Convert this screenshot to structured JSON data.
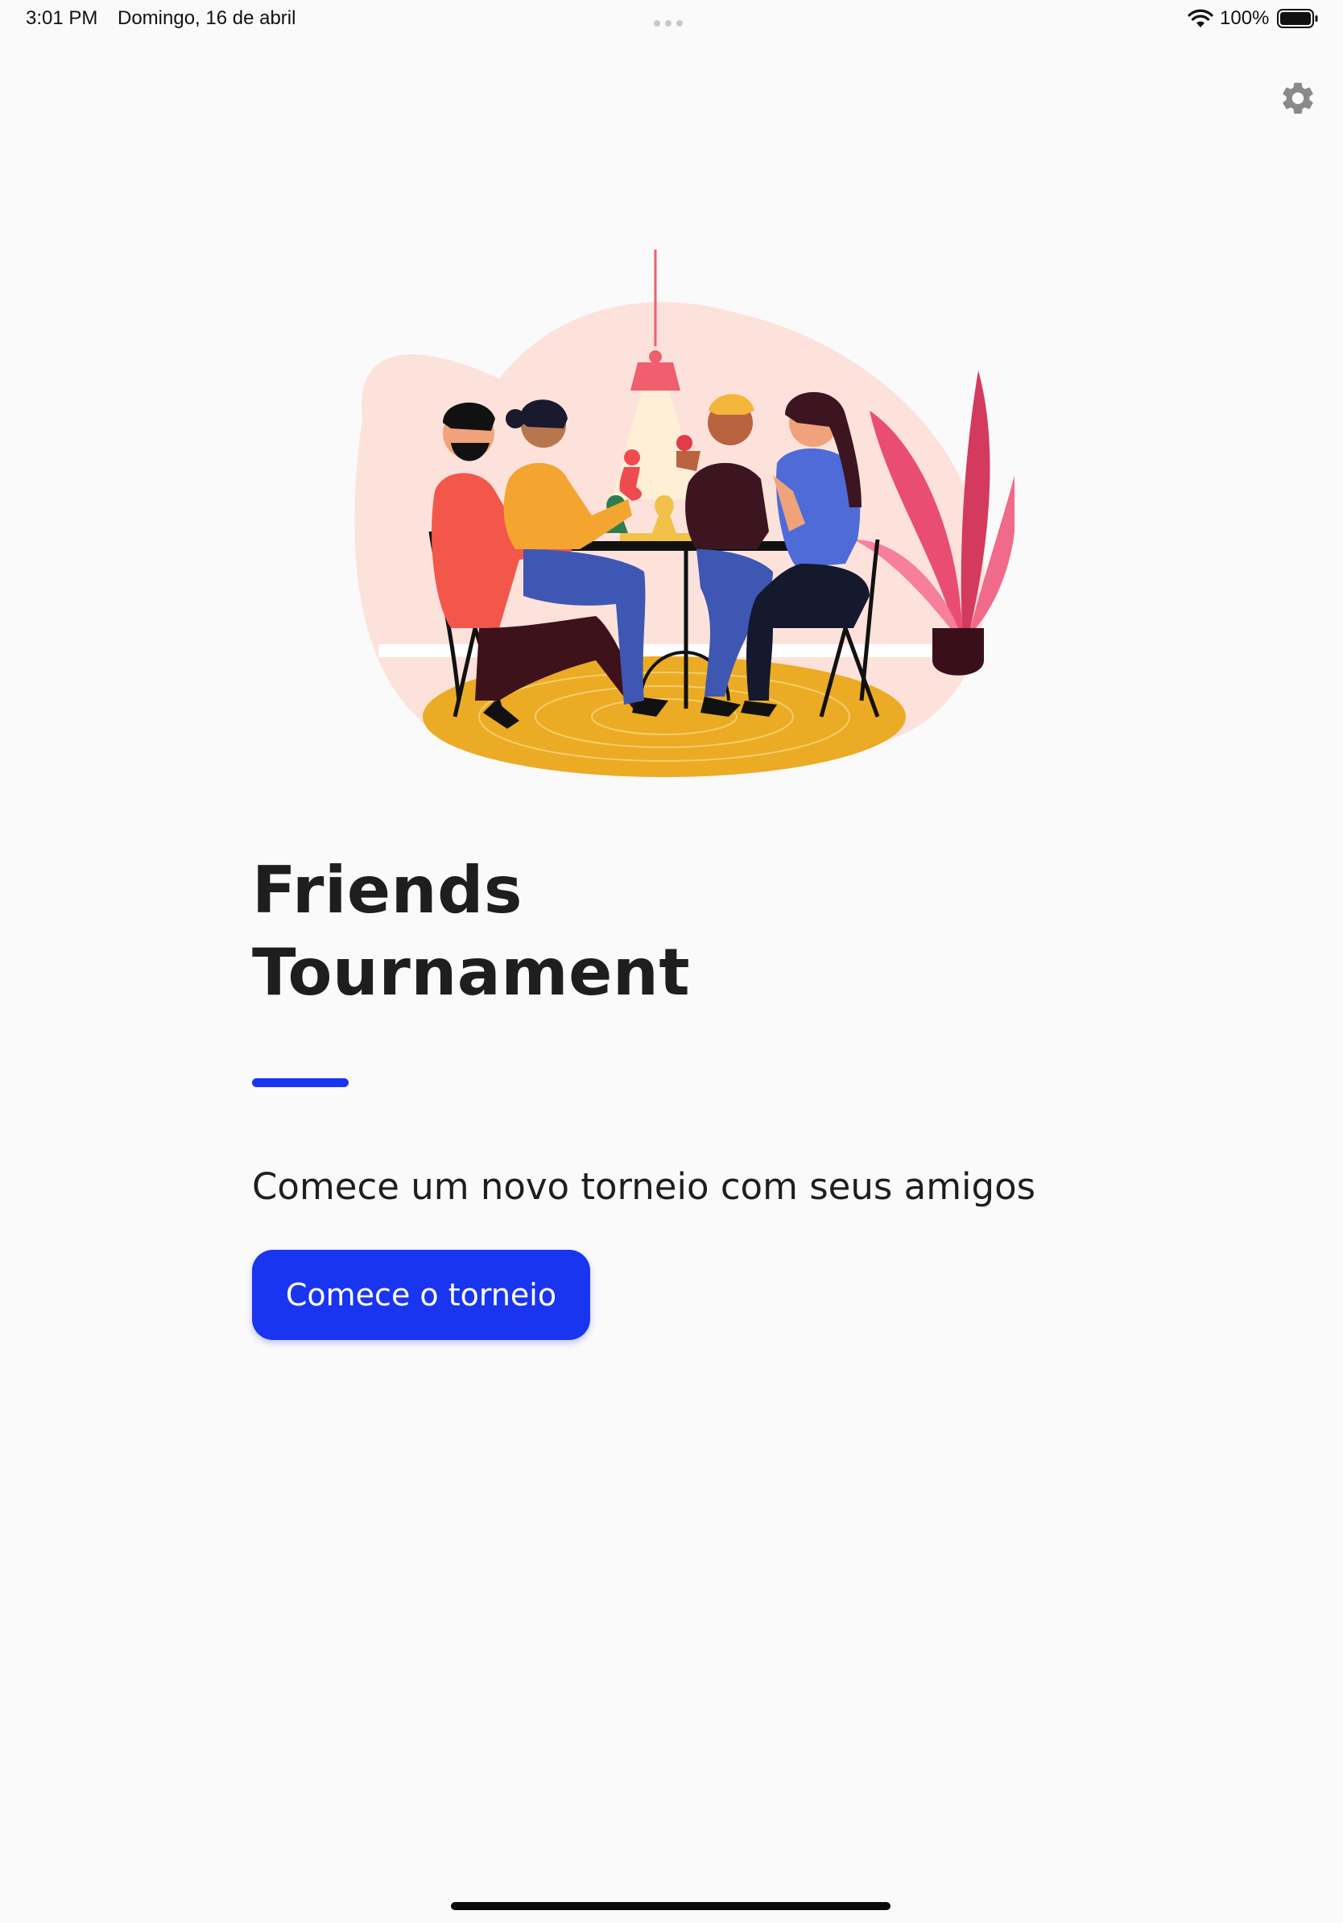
{
  "status_bar": {
    "time": "3:01 PM",
    "date": "Domingo, 16 de abril",
    "battery_percent": "100%",
    "battery_level": 1.0,
    "icons": [
      "wifi-icon",
      "battery-icon",
      "multitask-dots-icon"
    ]
  },
  "toolbar": {
    "settings_icon": "gear-icon"
  },
  "hero": {
    "illustration": "friends-playing-board-game-illustration",
    "title_line1": "Friends",
    "title_line2": "Tournament",
    "subtitle": "Comece um novo torneio com seus amigos",
    "start_button_label": "Comece o torneio"
  },
  "colors": {
    "accent": "#1a35f0",
    "background": "#fafafa",
    "title_text": "#1e1e1e"
  }
}
